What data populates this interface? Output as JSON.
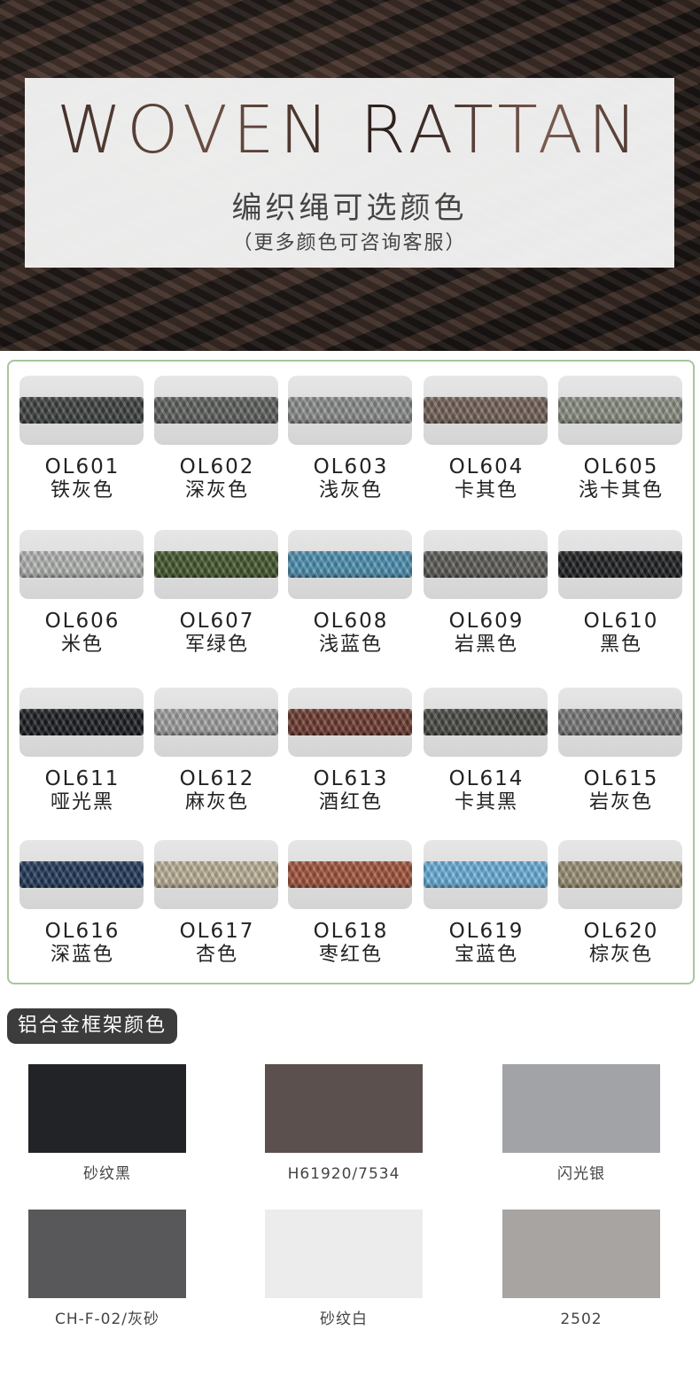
{
  "hero": {
    "title": "WOVEN RATTAN",
    "subtitle": "编织绳可选颜色",
    "note": "（更多颜色可咨询客服）"
  },
  "rope_colors": [
    {
      "code": "OL601",
      "name": "铁灰色",
      "color": "#3e4240"
    },
    {
      "code": "OL602",
      "name": "深灰色",
      "color": "#5f625f"
    },
    {
      "code": "OL603",
      "name": "浅灰色",
      "color": "#8d8f8f"
    },
    {
      "code": "OL604",
      "name": "卡其色",
      "color": "#75635a"
    },
    {
      "code": "OL605",
      "name": "浅卡其色",
      "color": "#8c9185"
    },
    {
      "code": "OL606",
      "name": "米色",
      "color": "#b6b8b6"
    },
    {
      "code": "OL607",
      "name": "军绿色",
      "color": "#44592e"
    },
    {
      "code": "OL608",
      "name": "浅蓝色",
      "color": "#4f92b3"
    },
    {
      "code": "OL609",
      "name": "岩黑色",
      "color": "#5d5c58"
    },
    {
      "code": "OL610",
      "name": "黑色",
      "color": "#1e1f21"
    },
    {
      "code": "OL611",
      "name": "哑光黑",
      "color": "#1b1d22"
    },
    {
      "code": "OL612",
      "name": "麻灰色",
      "color": "#a3a3a3"
    },
    {
      "code": "OL613",
      "name": "酒红色",
      "color": "#6e3b30"
    },
    {
      "code": "OL614",
      "name": "卡其黑",
      "color": "#4a4a45"
    },
    {
      "code": "OL615",
      "name": "岩灰色",
      "color": "#7a7a7a"
    },
    {
      "code": "OL616",
      "name": "深蓝色",
      "color": "#22395a"
    },
    {
      "code": "OL617",
      "name": "杏色",
      "color": "#bfb49b"
    },
    {
      "code": "OL618",
      "name": "枣红色",
      "color": "#a4553c"
    },
    {
      "code": "OL619",
      "name": "宝蓝色",
      "color": "#6cb2de"
    },
    {
      "code": "OL620",
      "name": "棕灰色",
      "color": "#9c9276"
    }
  ],
  "frame_section": {
    "title": "铝合金框架颜色",
    "items": [
      {
        "label": "砂纹黑",
        "color": "#222326"
      },
      {
        "label": "H61920/7534",
        "color": "#5b504d"
      },
      {
        "label": "闪光银",
        "color": "#a2a3a7"
      },
      {
        "label": "CH-F-02/灰砂",
        "color": "#58585a"
      },
      {
        "label": "砂纹白",
        "color": "#ececec"
      },
      {
        "label": "2502",
        "color": "#a7a4a1"
      }
    ]
  }
}
